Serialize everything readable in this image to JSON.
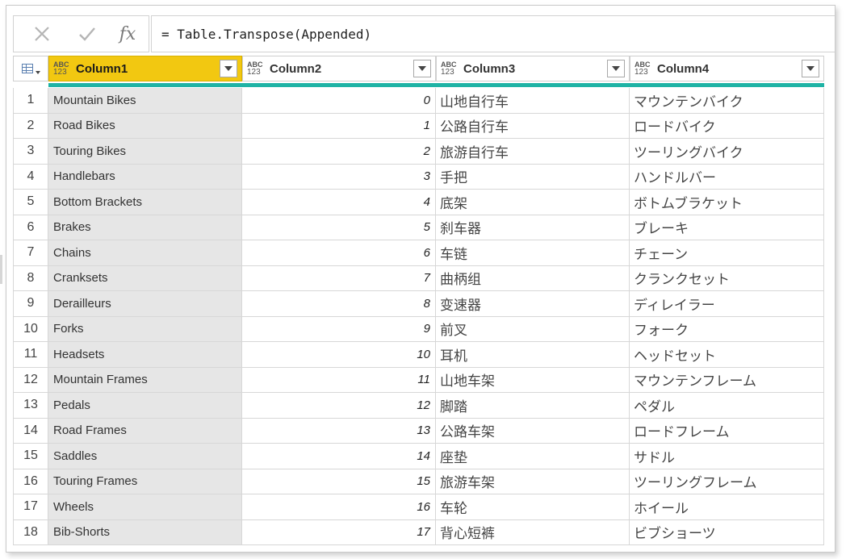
{
  "formula_bar": {
    "cancel_icon": "close-icon",
    "commit_icon": "check-icon",
    "fx_label": "fx",
    "formula": "= Table.Transpose(Appended)"
  },
  "header": {
    "type_top": "ABC",
    "type_bottom": "123",
    "columns": [
      "Column1",
      "Column2",
      "Column3",
      "Column4"
    ]
  },
  "colors": {
    "active_header": "#f2c811",
    "quality_bar": "#1fb3a5"
  },
  "rows": [
    {
      "idx": "1",
      "c1": "Mountain Bikes",
      "c2": "0",
      "c3": "山地自行车",
      "c4": "マウンテンバイク"
    },
    {
      "idx": "2",
      "c1": "Road Bikes",
      "c2": "1",
      "c3": "公路自行车",
      "c4": "ロードバイク"
    },
    {
      "idx": "3",
      "c1": "Touring Bikes",
      "c2": "2",
      "c3": "旅游自行车",
      "c4": "ツーリングバイク"
    },
    {
      "idx": "4",
      "c1": "Handlebars",
      "c2": "3",
      "c3": "手把",
      "c4": "ハンドルバー"
    },
    {
      "idx": "5",
      "c1": "Bottom Brackets",
      "c2": "4",
      "c3": "底架",
      "c4": "ボトムブラケット"
    },
    {
      "idx": "6",
      "c1": "Brakes",
      "c2": "5",
      "c3": "刹车器",
      "c4": "ブレーキ"
    },
    {
      "idx": "7",
      "c1": "Chains",
      "c2": "6",
      "c3": "车链",
      "c4": "チェーン"
    },
    {
      "idx": "8",
      "c1": "Cranksets",
      "c2": "7",
      "c3": "曲柄组",
      "c4": "クランクセット"
    },
    {
      "idx": "9",
      "c1": "Derailleurs",
      "c2": "8",
      "c3": "变速器",
      "c4": "ディレイラー"
    },
    {
      "idx": "10",
      "c1": "Forks",
      "c2": "9",
      "c3": "前叉",
      "c4": "フォーク"
    },
    {
      "idx": "11",
      "c1": "Headsets",
      "c2": "10",
      "c3": "耳机",
      "c4": "ヘッドセット"
    },
    {
      "idx": "12",
      "c1": "Mountain Frames",
      "c2": "11",
      "c3": "山地车架",
      "c4": "マウンテンフレーム"
    },
    {
      "idx": "13",
      "c1": "Pedals",
      "c2": "12",
      "c3": "脚踏",
      "c4": "ペダル"
    },
    {
      "idx": "14",
      "c1": "Road Frames",
      "c2": "13",
      "c3": "公路车架",
      "c4": "ロードフレーム"
    },
    {
      "idx": "15",
      "c1": "Saddles",
      "c2": "14",
      "c3": "座垫",
      "c4": "サドル"
    },
    {
      "idx": "16",
      "c1": "Touring Frames",
      "c2": "15",
      "c3": "旅游车架",
      "c4": "ツーリングフレーム"
    },
    {
      "idx": "17",
      "c1": "Wheels",
      "c2": "16",
      "c3": "车轮",
      "c4": "ホイール"
    },
    {
      "idx": "18",
      "c1": "Bib-Shorts",
      "c2": "17",
      "c3": "背心短裤",
      "c4": "ビブショーツ"
    }
  ]
}
